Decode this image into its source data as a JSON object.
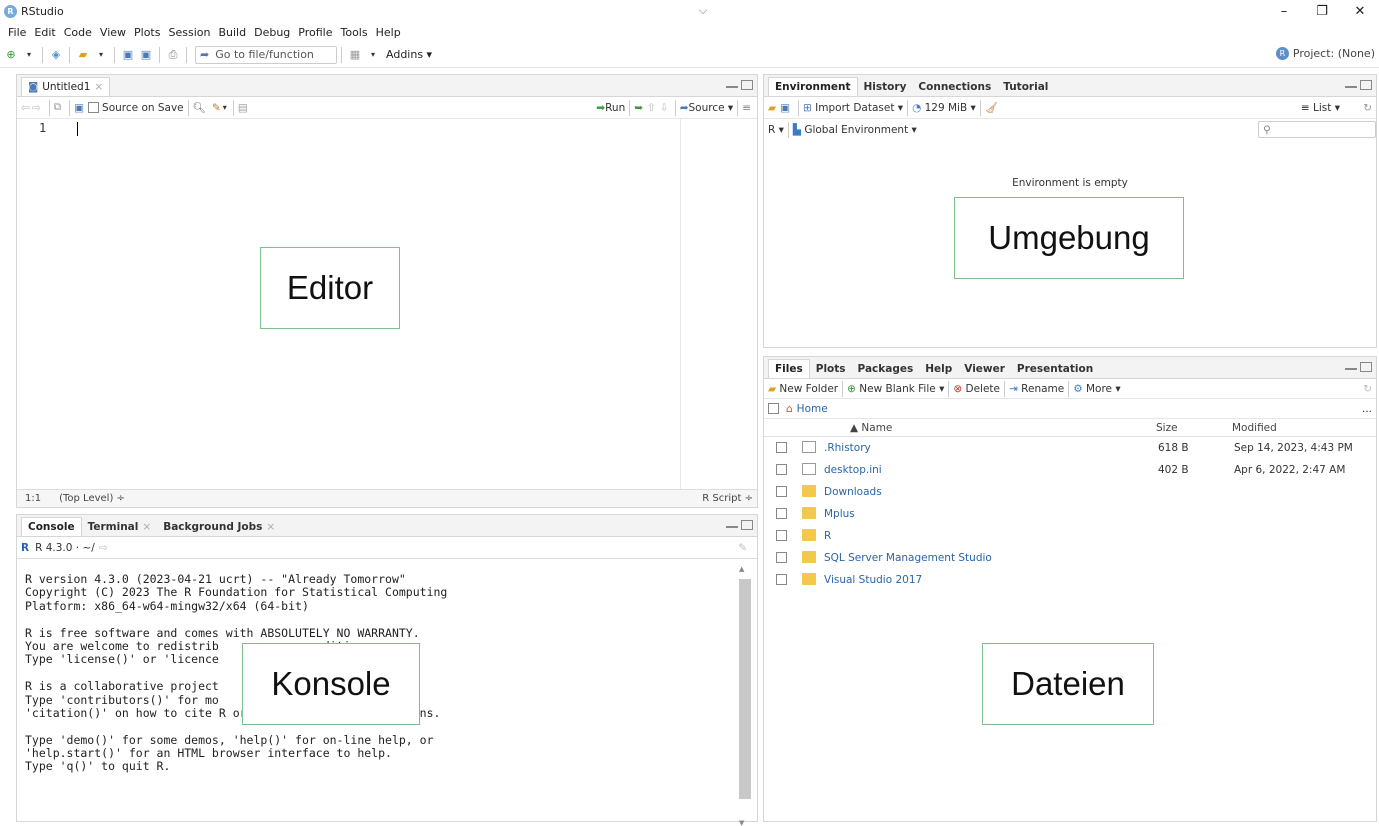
{
  "window": {
    "title": "RStudio",
    "logo_letter": "R",
    "chevron": "⌵",
    "controls": [
      "–",
      "❐",
      "✕"
    ]
  },
  "menu": [
    "File",
    "Edit",
    "Code",
    "View",
    "Plots",
    "Session",
    "Build",
    "Debug",
    "Profile",
    "Tools",
    "Help"
  ],
  "toolbar": {
    "goto_placeholder": "Go to file/function",
    "addins": "Addins",
    "project": "Project: (None)"
  },
  "editor": {
    "tab": "Untitled1",
    "source_on_save": "Source on Save",
    "run": "Run",
    "source": "Source",
    "line_number": "1",
    "status_position": "1:1",
    "status_scope": "(Top Level) ÷",
    "status_type": "R Script ÷"
  },
  "console": {
    "tabs": [
      "Console",
      "Terminal",
      "Background Jobs"
    ],
    "version_label": "R 4.3.0 · ~/",
    "lines": [
      "R version 4.3.0 (2023-04-21 ucrt) -- \"Already Tomorrow\"",
      "Copyright (C) 2023 The R Foundation for Statistical Computing",
      "Platform: x86_64-w64-mingw32/x64 (64-bit)",
      "",
      "R is free software and comes with ABSOLUTELY NO WARRANTY.",
      "You are welcome to redistrib              nditions.",
      "Type 'license()' or 'licence              tails.",
      "",
      "R is a collaborative project",
      "Type 'contributors()' for mo",
      "'citation()' on how to cite R or R packages in publications.",
      "",
      "Type 'demo()' for some demos, 'help()' for on-line help, or",
      "'help.start()' for an HTML browser interface to help.",
      "Type 'q()' to quit R."
    ]
  },
  "environment": {
    "tabs": [
      "Environment",
      "History",
      "Connections",
      "Tutorial"
    ],
    "import_dataset": "Import Dataset",
    "memory": "129 MiB",
    "list_label": "List",
    "r_label": "R",
    "global_env": "Global Environment",
    "empty_message": "Environment is empty"
  },
  "files": {
    "tabs": [
      "Files",
      "Plots",
      "Packages",
      "Help",
      "Viewer",
      "Presentation"
    ],
    "new_folder": "New Folder",
    "new_blank_file": "New Blank File",
    "delete": "Delete",
    "rename": "Rename",
    "more": "More",
    "home": "Home",
    "ellipsis": "...",
    "columns": {
      "name": "▲ Name",
      "size": "Size",
      "modified": "Modified"
    },
    "rows": [
      {
        "name": ".Rhistory",
        "size": "618 B",
        "modified": "Sep 14, 2023, 4:43 PM",
        "type": "file"
      },
      {
        "name": "desktop.ini",
        "size": "402 B",
        "modified": "Apr 6, 2022, 2:47 AM",
        "type": "file"
      },
      {
        "name": "Downloads",
        "size": "",
        "modified": "",
        "type": "folder"
      },
      {
        "name": "Mplus",
        "size": "",
        "modified": "",
        "type": "folder"
      },
      {
        "name": "R",
        "size": "",
        "modified": "",
        "type": "folder"
      },
      {
        "name": "SQL Server Management Studio",
        "size": "",
        "modified": "",
        "type": "folder"
      },
      {
        "name": "Visual Studio 2017",
        "size": "",
        "modified": "",
        "type": "folder"
      }
    ]
  },
  "labels": {
    "editor": "Editor",
    "umgebung": "Umgebung",
    "konsole": "Konsole",
    "dateien": "Dateien"
  },
  "colors": {
    "accent_blue": "#75aadb",
    "overlay_border": "#7fbf8f",
    "folder": "#f2c94c"
  }
}
